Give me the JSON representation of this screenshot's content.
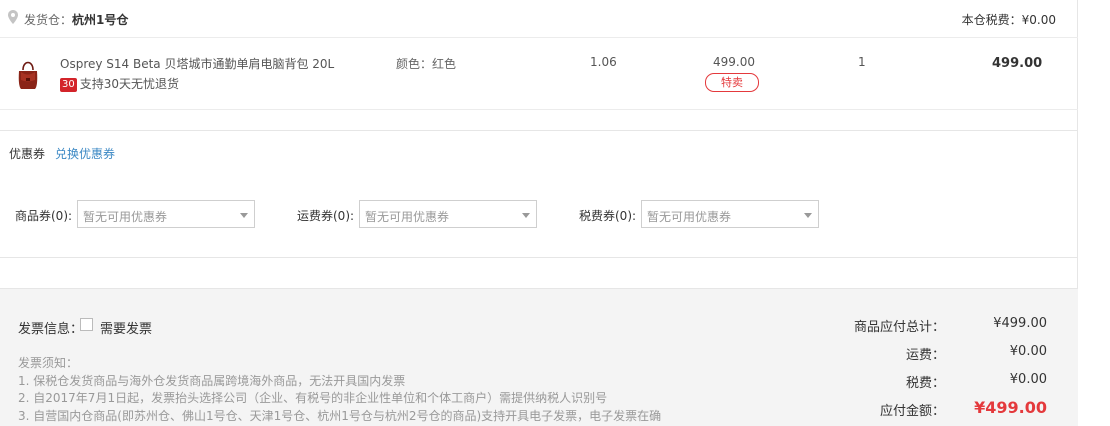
{
  "warehouse": {
    "label": "发货仓：",
    "name": "杭州1号仓",
    "tax_label": "本仓税费：¥0.00"
  },
  "product": {
    "name": "Osprey S14 Beta 贝塔城市通勤单肩电脑背包 20L",
    "return_icon": "30",
    "return_text": "支持30天无忧退货",
    "attr": "颜色：红色",
    "weight": "1.06",
    "price": "499.00",
    "badge": "特卖",
    "qty": "1",
    "subtotal": "499.00",
    "icon": "shoulder-bag-icon"
  },
  "coupons": {
    "title": "优惠券",
    "link": "兑换优惠券",
    "items": [
      {
        "label": "商品券(0):",
        "placeholder": "暂无可用优惠券"
      },
      {
        "label": "运费券(0):",
        "placeholder": "暂无可用优惠券"
      },
      {
        "label": "税费券(0):",
        "placeholder": "暂无可用优惠券"
      }
    ]
  },
  "invoice": {
    "label": "发票信息：",
    "checkbox_label": "需要发票",
    "notes_title": "发票须知：",
    "notes": [
      "1. 保税仓发货商品与海外仓发货商品属跨境海外商品，无法开具国内发票",
      "2. 自2017年7月1日起，发票抬头选择公司（企业、有税号的非企业性单位和个体工商户）需提供纳税人识别号",
      "3. 自营国内仓商品(即苏州仓、佛山1号仓、天津1号仓、杭州1号仓与杭州2号仓的商品)支持开具电子发票，电子发票在确"
    ]
  },
  "summary": {
    "goods_label": "商品应付总计：",
    "goods_value": "¥499.00",
    "shipping_label": "运费：",
    "shipping_value": "¥0.00",
    "tax_label": "税费：",
    "tax_value": "¥0.00",
    "total_label": "应付金额：",
    "total_value": "¥499.00"
  },
  "colors": {
    "accent_red": "#e4393c",
    "link_blue": "#3b88c4"
  }
}
